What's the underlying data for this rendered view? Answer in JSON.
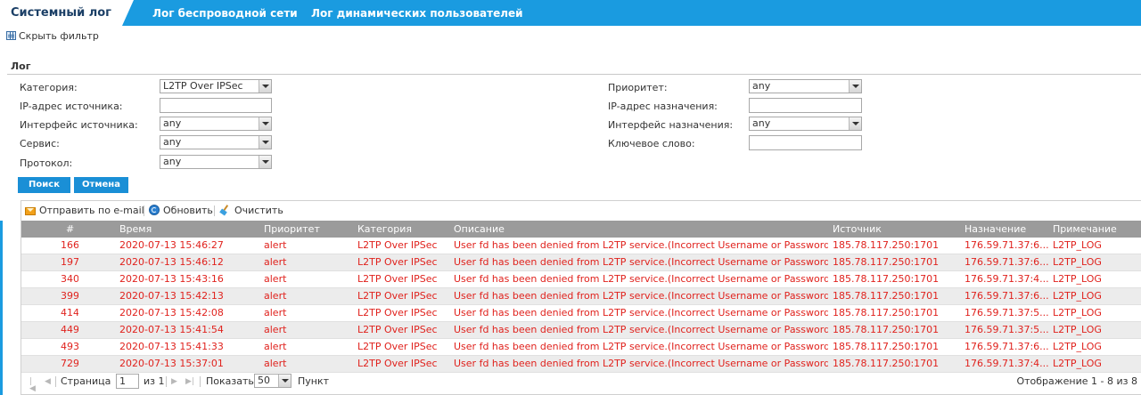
{
  "tabs": [
    {
      "label": "Системный лог",
      "active": true
    },
    {
      "label": "Лог беспроводной сети",
      "active": false
    },
    {
      "label": "Лог динамических пользователей",
      "active": false
    }
  ],
  "filter_toggle": {
    "label": "Скрыть фильтр",
    "icon": "table-icon"
  },
  "section": {
    "title": "Лог"
  },
  "filters": {
    "category": {
      "label": "Категория:",
      "value": "L2TP Over IPSec"
    },
    "src_ip": {
      "label": "IP-адрес источника:",
      "value": ""
    },
    "src_iface": {
      "label": "Интерфейс источника:",
      "value": "any"
    },
    "service": {
      "label": "Сервис:",
      "value": "any"
    },
    "protocol": {
      "label": "Протокол:",
      "value": "any"
    },
    "priority": {
      "label": "Приоритет:",
      "value": "any"
    },
    "dst_ip": {
      "label": "IP-адрес назначения:",
      "value": ""
    },
    "dst_iface": {
      "label": "Интерфейс назначения:",
      "value": "any"
    },
    "keyword": {
      "label": "Ключевое слово:",
      "value": ""
    }
  },
  "buttons": {
    "search": "Поиск",
    "cancel": "Отмена"
  },
  "toolbar": {
    "email": "Отправить по e-mail",
    "refresh": "Обновить",
    "clear": "Очистить"
  },
  "columns": [
    "#",
    "Время",
    "Приоритет",
    "Категория",
    "Описание",
    "Источник",
    "Назначение",
    "Примечание"
  ],
  "rows": [
    [
      "166",
      "2020-07-13 15:46:27",
      "alert",
      "L2TP Over IPSec",
      "User fd has been denied from L2TP service.(Incorrect Username or Password)",
      "185.78.117.250:1701",
      "176.59.71.37:6...",
      "L2TP_LOG"
    ],
    [
      "197",
      "2020-07-13 15:46:12",
      "alert",
      "L2TP Over IPSec",
      "User fd has been denied from L2TP service.(Incorrect Username or Password)",
      "185.78.117.250:1701",
      "176.59.71.37:6...",
      "L2TP_LOG"
    ],
    [
      "340",
      "2020-07-13 15:43:16",
      "alert",
      "L2TP Over IPSec",
      "User fd has been denied from L2TP service.(Incorrect Username or Password)",
      "185.78.117.250:1701",
      "176.59.71.37:4...",
      "L2TP_LOG"
    ],
    [
      "399",
      "2020-07-13 15:42:13",
      "alert",
      "L2TP Over IPSec",
      "User fd has been denied from L2TP service.(Incorrect Username or Password)",
      "185.78.117.250:1701",
      "176.59.71.37:6...",
      "L2TP_LOG"
    ],
    [
      "414",
      "2020-07-13 15:42:08",
      "alert",
      "L2TP Over IPSec",
      "User fd has been denied from L2TP service.(Incorrect Username or Password)",
      "185.78.117.250:1701",
      "176.59.71.37:5...",
      "L2TP_LOG"
    ],
    [
      "449",
      "2020-07-13 15:41:54",
      "alert",
      "L2TP Over IPSec",
      "User fd has been denied from L2TP service.(Incorrect Username or Password)",
      "185.78.117.250:1701",
      "176.59.71.37:5...",
      "L2TP_LOG"
    ],
    [
      "493",
      "2020-07-13 15:41:33",
      "alert",
      "L2TP Over IPSec",
      "User fd has been denied from L2TP service.(Incorrect Username or Password)",
      "185.78.117.250:1701",
      "176.59.71.37:6...",
      "L2TP_LOG"
    ],
    [
      "729",
      "2020-07-13 15:37:01",
      "alert",
      "L2TP Over IPSec",
      "User fd has been denied from L2TP service.(Incorrect Username or Password)",
      "185.78.117.250:1701",
      "176.59.71.37:4...",
      "L2TP_LOG"
    ]
  ],
  "pager": {
    "page_label": "Страница",
    "page_value": "1",
    "of_label": "из 1",
    "show_label": "Показать",
    "per_page": "50",
    "items_label": "Пункт",
    "summary": "Отображение 1 - 8 из 8"
  },
  "colors": {
    "accent": "#1a9be0",
    "alert_text": "#e0221d",
    "header_bg": "#9b9b9b"
  }
}
